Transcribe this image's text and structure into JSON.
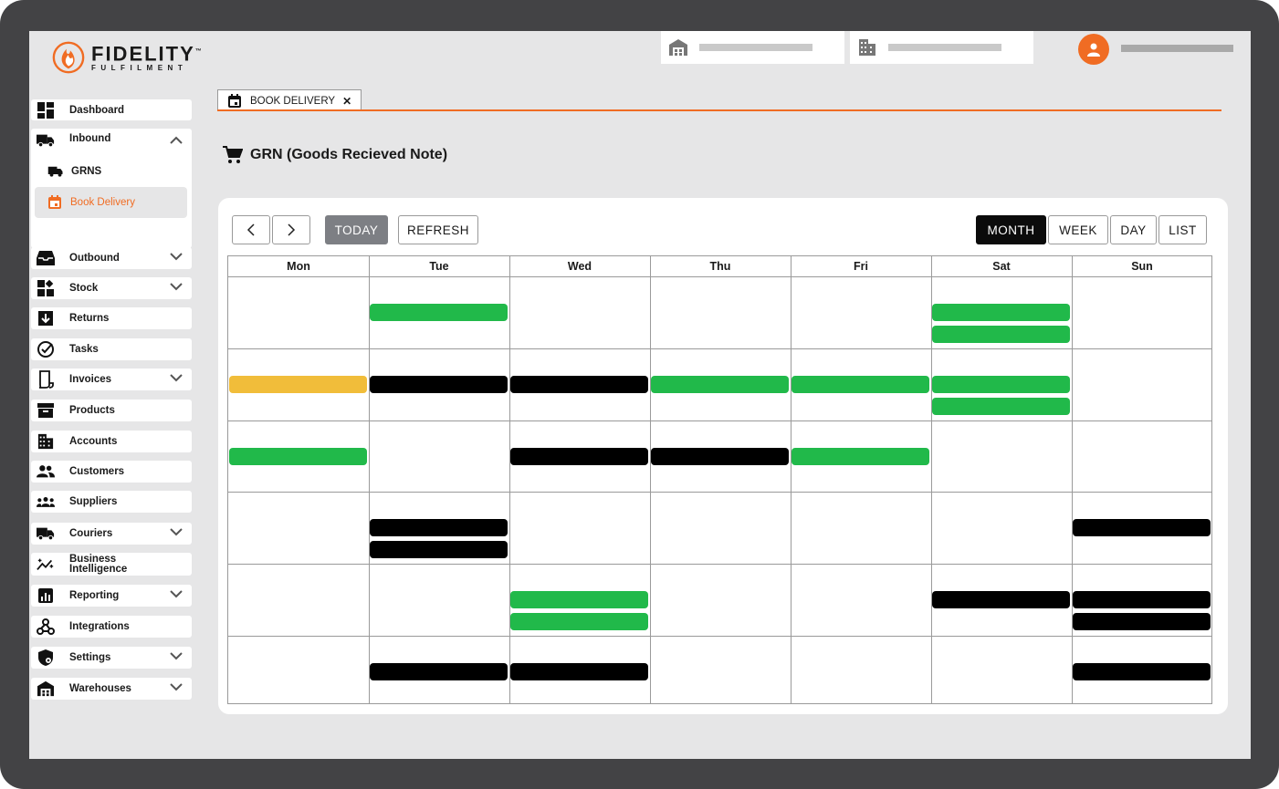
{
  "brand": {
    "name": "FIDELITY",
    "tm": "™",
    "tagline": "FULFILMENT"
  },
  "colors": {
    "accent": "#f06c23",
    "event_green": "#21b94a",
    "event_black": "#000000",
    "event_yellow": "#f1bd3a"
  },
  "sidebar": {
    "items": [
      {
        "label": "Dashboard",
        "icon": "dashboard-icon"
      },
      {
        "label": "Inbound",
        "icon": "truck-icon",
        "expanded": true
      },
      {
        "label": "Outbound",
        "icon": "inbox-tray-icon"
      },
      {
        "label": "Stock",
        "icon": "widgets-icon"
      },
      {
        "label": "Returns",
        "icon": "return-arrow-icon"
      },
      {
        "label": "Tasks",
        "icon": "check-circle-icon"
      },
      {
        "label": "Invoices",
        "icon": "invoice-icon"
      },
      {
        "label": "Products",
        "icon": "archive-box-icon"
      },
      {
        "label": "Accounts",
        "icon": "building-icon"
      },
      {
        "label": "Customers",
        "icon": "people-icon"
      },
      {
        "label": "Suppliers",
        "icon": "group-icon"
      },
      {
        "label": "Couriers",
        "icon": "truck-icon"
      },
      {
        "label": "Business Intelligence",
        "icon": "trend-sparkle-icon"
      },
      {
        "label": "Reporting",
        "icon": "bar-chart-icon"
      },
      {
        "label": "Integrations",
        "icon": "webhook-icon"
      },
      {
        "label": "Settings",
        "icon": "shield-gear-icon"
      },
      {
        "label": "Warehouses",
        "icon": "warehouse-icon"
      }
    ],
    "inbound_sub": [
      {
        "label": "GRNS",
        "icon": "truck-icon"
      },
      {
        "label": "Book Delivery",
        "icon": "calendar-icon",
        "active": true
      }
    ]
  },
  "tab": {
    "label": "BOOK DELIVERY",
    "close": "✕"
  },
  "page": {
    "title": "GRN (Goods Recieved Note)"
  },
  "toolbar": {
    "prev": "‹",
    "next": "›",
    "today": "TODAY",
    "refresh": "REFRESH",
    "views": [
      "MONTH",
      "WEEK",
      "DAY",
      "LIST"
    ],
    "selected_view": "MONTH"
  },
  "calendar": {
    "days": [
      "Mon",
      "Tue",
      "Wed",
      "Thu",
      "Fri",
      "Sat",
      "Sun"
    ],
    "weeks": [
      [
        [],
        [
          "green"
        ],
        [],
        [],
        [],
        [
          "green",
          "green"
        ],
        []
      ],
      [
        [
          "yellow"
        ],
        [
          "black"
        ],
        [
          "black"
        ],
        [
          "green"
        ],
        [
          "green"
        ],
        [
          "green",
          "green"
        ],
        []
      ],
      [
        [
          "green"
        ],
        [],
        [
          "black"
        ],
        [
          "black"
        ],
        [
          "green"
        ],
        [],
        []
      ],
      [
        [],
        [
          "black",
          "black"
        ],
        [],
        [],
        [],
        [],
        [
          "black"
        ]
      ],
      [
        [],
        [],
        [
          "green",
          "green"
        ],
        [],
        [],
        [
          "black"
        ],
        [
          "black",
          "black"
        ]
      ],
      [
        [],
        [
          "black"
        ],
        [
          "black"
        ],
        [],
        [],
        [],
        [
          "black"
        ]
      ]
    ]
  }
}
